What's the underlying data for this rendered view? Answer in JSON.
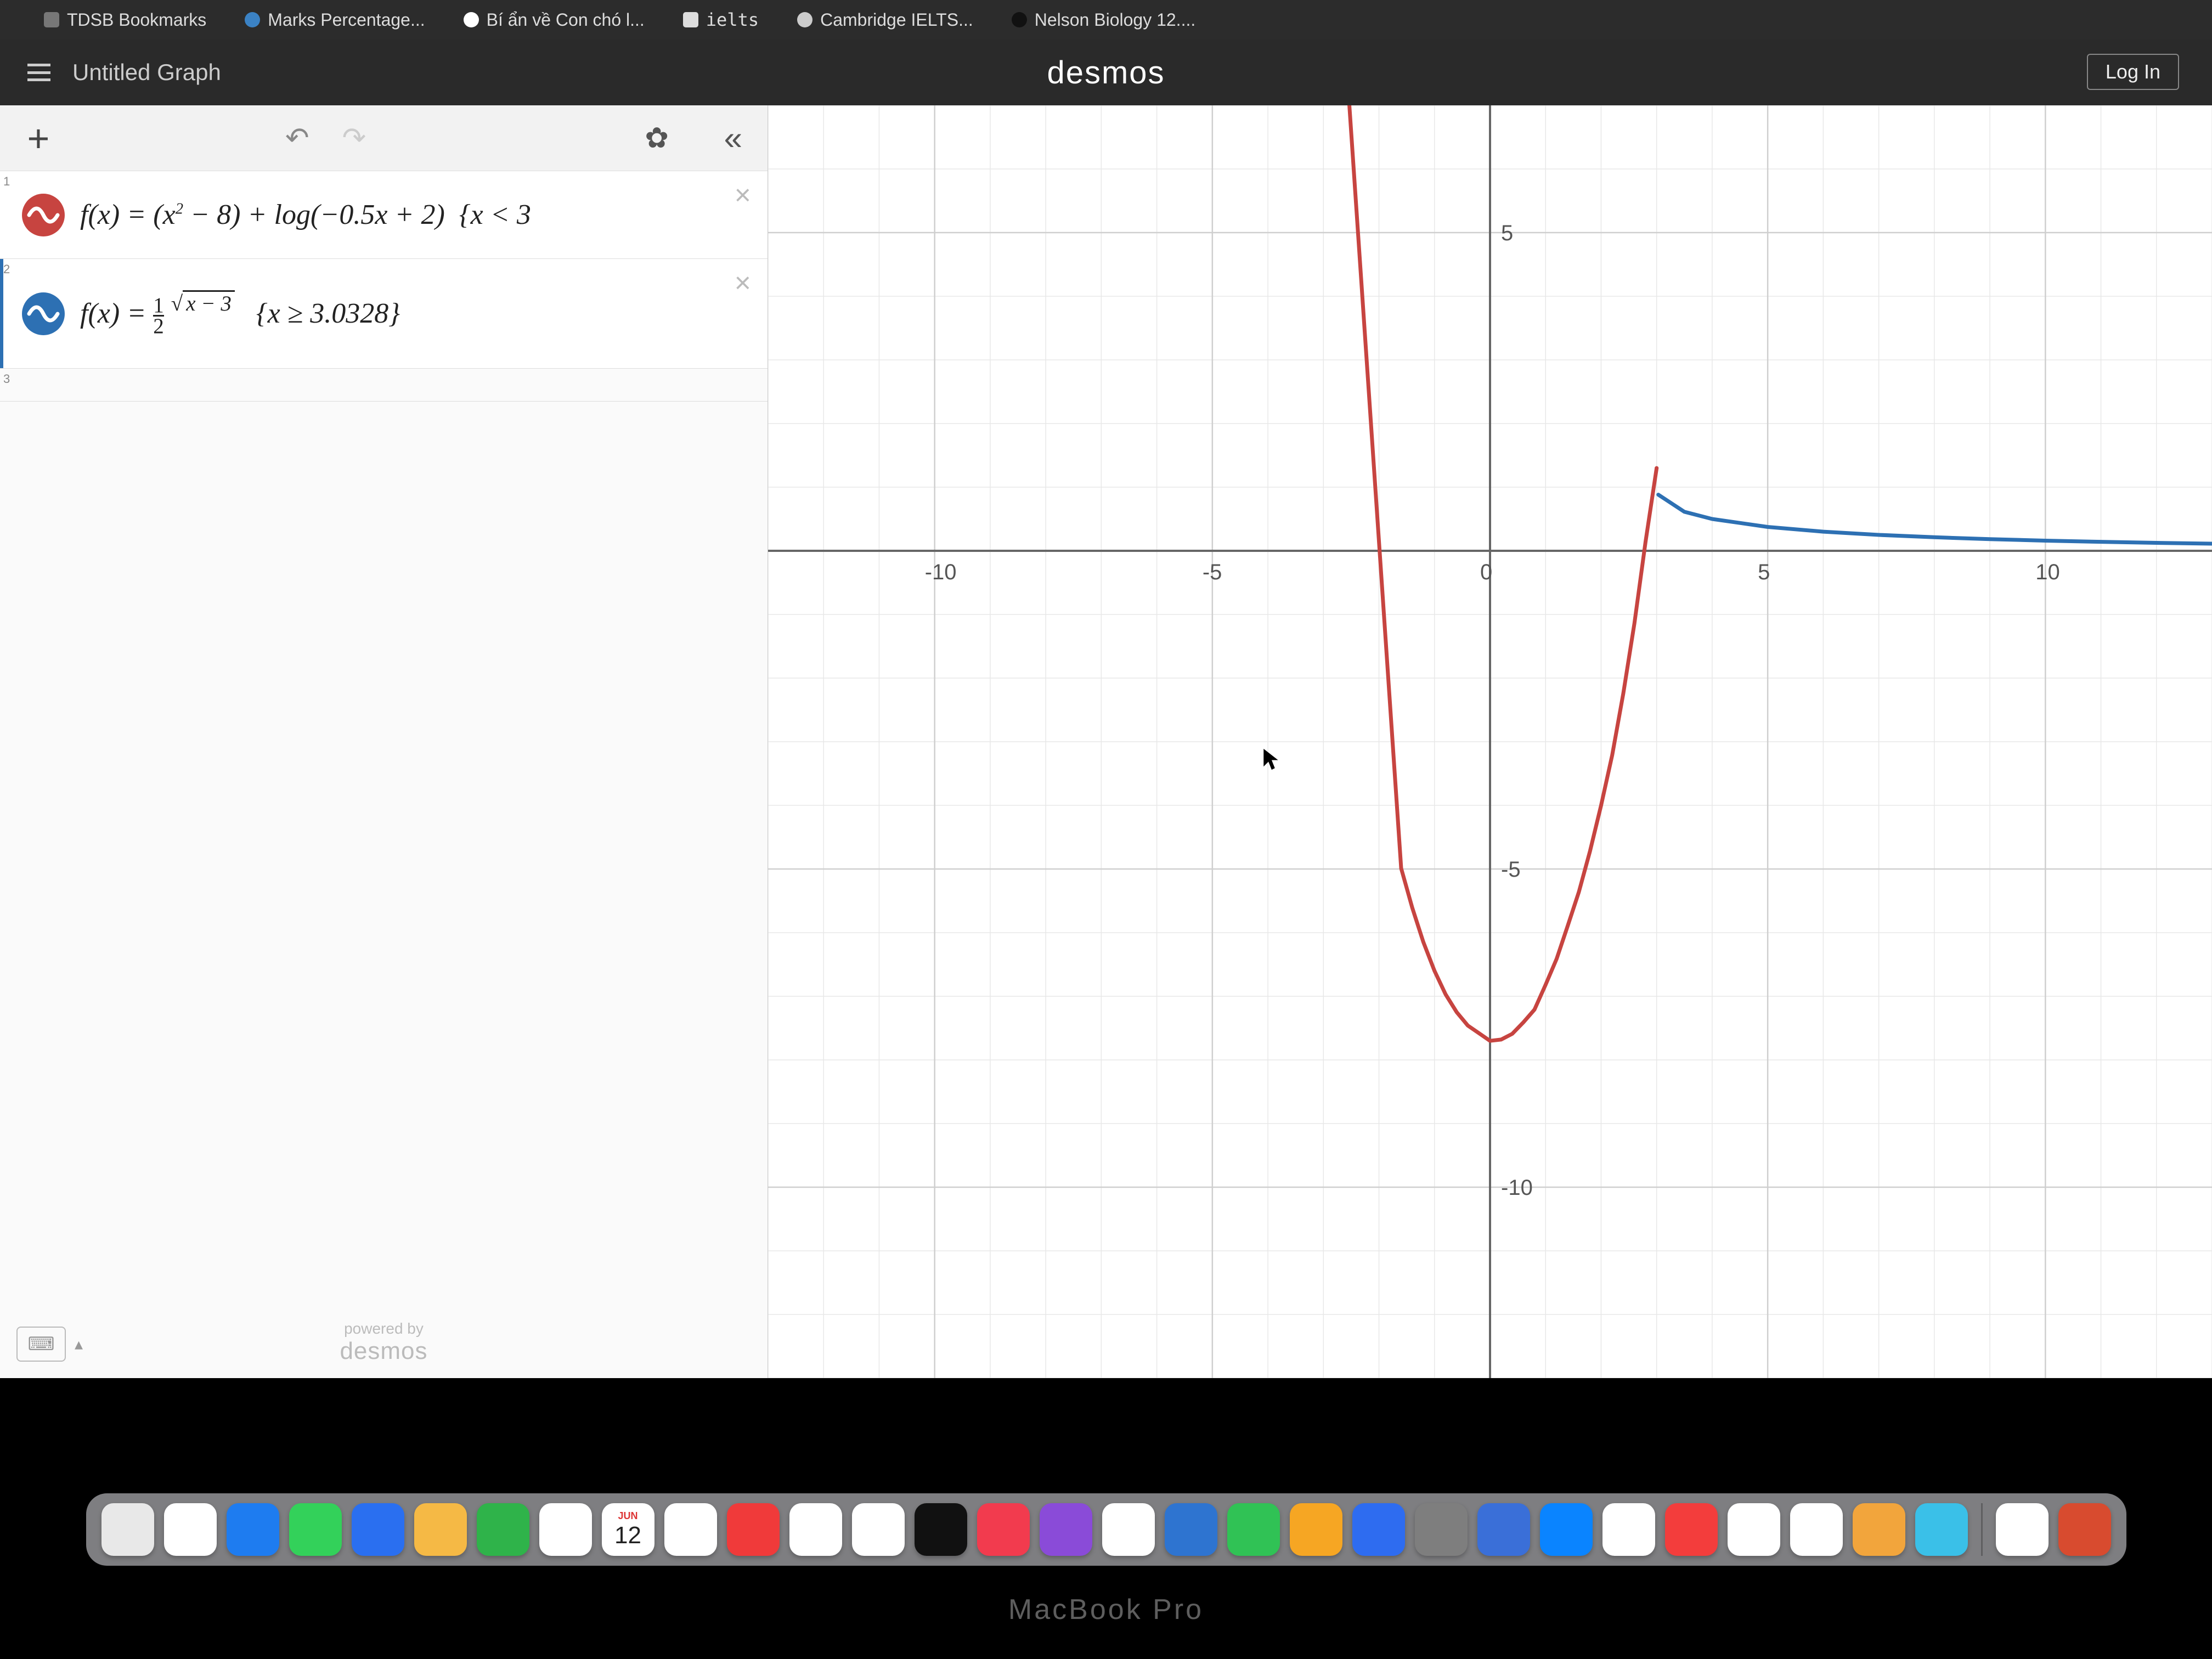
{
  "bookmarks": {
    "items": [
      {
        "label": "TDSB Bookmarks"
      },
      {
        "label": "Marks Percentage..."
      },
      {
        "label": "Bí ẩn về Con chó l..."
      },
      {
        "label": "ielts"
      },
      {
        "label": "Cambridge IELTS..."
      },
      {
        "label": "Nelson Biology 12...."
      }
    ]
  },
  "header": {
    "graph_title": "Untitled Graph",
    "brand": "desmos",
    "login_label": "Log In"
  },
  "toolbar": {
    "add_label": "+",
    "undo_glyph": "↶",
    "redo_glyph": "↷",
    "gear_glyph": "✿",
    "collapse_glyph": "«"
  },
  "expressions": {
    "items": [
      {
        "index": "1",
        "color": "#c74440",
        "latex_repr": "f(x) = (x² − 8) + log(−0.5x + 2)  {x < 3",
        "selected": false
      },
      {
        "index": "2",
        "color": "#2d70b3",
        "latex_repr": "f(x) = ½ √(x − 3)   {x ≥ 3.0328}",
        "selected": true
      }
    ],
    "row3_index": "3"
  },
  "panel_footer": {
    "powered_by": "powered by",
    "brand": "desmos"
  },
  "chart_data": {
    "type": "line",
    "title": "",
    "xlabel": "",
    "ylabel": "",
    "xlim": [
      -13,
      13
    ],
    "ylim": [
      -13,
      7
    ],
    "x_ticks": [
      -10,
      -5,
      0,
      5,
      10
    ],
    "y_ticks": [
      -10,
      -5,
      5
    ],
    "grid": true,
    "series": [
      {
        "name": "f(x) = (x^2 - 8) + log(-0.5x + 2), x < 3",
        "color": "#c74440",
        "x": [
          -1.6,
          -1.4,
          -1.2,
          -1.0,
          -0.8,
          -0.6,
          -0.4,
          -0.2,
          0.0,
          0.2,
          0.4,
          0.6,
          0.8,
          1.0,
          1.2,
          1.4,
          1.6,
          1.8,
          2.0,
          2.2,
          2.4,
          2.6,
          2.8,
          3.0
        ],
        "y": [
          -4.99,
          -5.61,
          -6.15,
          -6.6,
          -6.97,
          -7.25,
          -7.46,
          -7.58,
          -7.7,
          -7.68,
          -7.59,
          -7.41,
          -7.21,
          -6.82,
          -6.41,
          -5.89,
          -5.36,
          -4.72,
          -4.0,
          -3.21,
          -2.24,
          -1.14,
          0.14,
          1.3
        ]
      },
      {
        "name": "f(x) = (1/2)^sqrt(x-3), x >= 3.0328",
        "color": "#2d70b3",
        "x": [
          3.03,
          3.5,
          4,
          5,
          6,
          7,
          8,
          9,
          10,
          11,
          12,
          13
        ],
        "y": [
          0.882,
          0.613,
          0.5,
          0.375,
          0.301,
          0.25,
          0.213,
          0.183,
          0.16,
          0.141,
          0.125,
          0.112
        ]
      }
    ]
  },
  "dock": {
    "calendar_month": "JUN",
    "calendar_day": "12"
  },
  "hardware_label": "MacBook Pro"
}
